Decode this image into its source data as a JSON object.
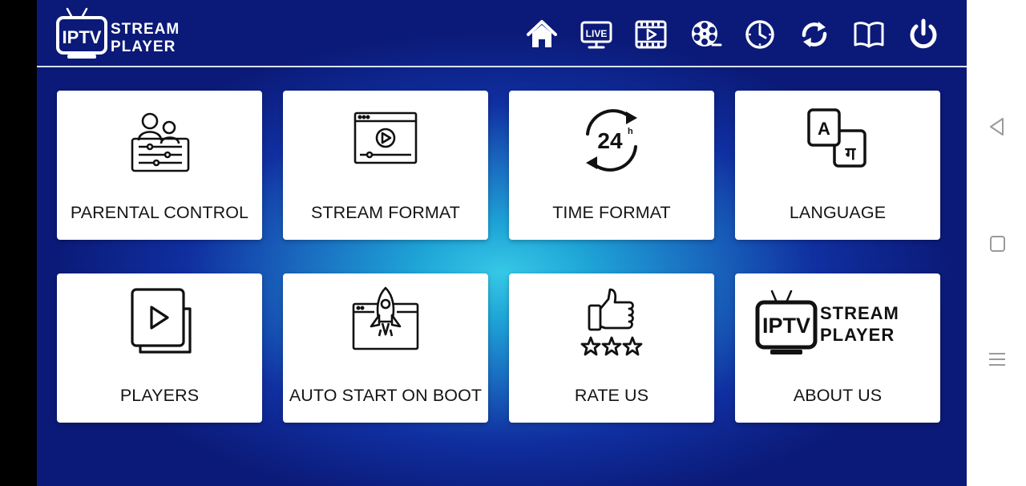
{
  "app": {
    "logo": {
      "badge": "IPTV",
      "line1": "STREAM",
      "line2": "PLAYER"
    },
    "nav": [
      {
        "name": "home-icon"
      },
      {
        "name": "live-tv-icon",
        "text": "LIVE"
      },
      {
        "name": "movies-icon"
      },
      {
        "name": "series-reel-icon"
      },
      {
        "name": "catchup-clock-icon"
      },
      {
        "name": "reload-icon"
      },
      {
        "name": "guide-book-icon"
      },
      {
        "name": "power-icon"
      }
    ],
    "tiles": [
      {
        "label": "PARENTAL CONTROL"
      },
      {
        "label": "STREAM FORMAT"
      },
      {
        "label": "TIME FORMAT",
        "icon_text": "24",
        "icon_sup": "h"
      },
      {
        "label": "LANGUAGE",
        "icon_text_a": "A",
        "icon_text_b": "ग"
      },
      {
        "label": "PLAYERS"
      },
      {
        "label": "AUTO START ON BOOT"
      },
      {
        "label": "RATE US"
      },
      {
        "label": "ABOUT US",
        "logo": {
          "badge": "IPTV",
          "line1": "STREAM",
          "line2": "PLAYER"
        }
      }
    ]
  },
  "system_nav": [
    {
      "name": "back-icon"
    },
    {
      "name": "recents-icon"
    },
    {
      "name": "menu-icon"
    }
  ],
  "colors": {
    "accent_dark": "#0b1a78",
    "accent_glow": "#36c8e6",
    "card": "#ffffff",
    "text": "#141414"
  }
}
